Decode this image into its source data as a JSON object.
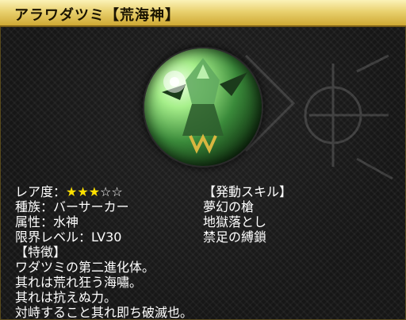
{
  "title": "アラワダツミ【荒海神】",
  "stats": {
    "rarity_label": "レア度：",
    "rarity_filled": "★★★",
    "rarity_empty": "☆☆",
    "race": "種族：バーサーカー",
    "attribute": "属性：水神",
    "limit_level": "限界レベル：LV30"
  },
  "features": {
    "header": "【特徴】",
    "lines": [
      "ワダツミの第二進化体。",
      "其れは荒れ狂う海嘯。",
      "其れは抗えぬ力。",
      "対峙すること其れ即ち破滅也。"
    ]
  },
  "skills": {
    "header": "【発動スキル】",
    "items": [
      "夢幻の槍",
      "地獄落とし",
      "禁足の縛鎖"
    ]
  },
  "colors": {
    "title_bar": "#e9d16f",
    "star": "#ffe000",
    "text": "#ffffff"
  }
}
